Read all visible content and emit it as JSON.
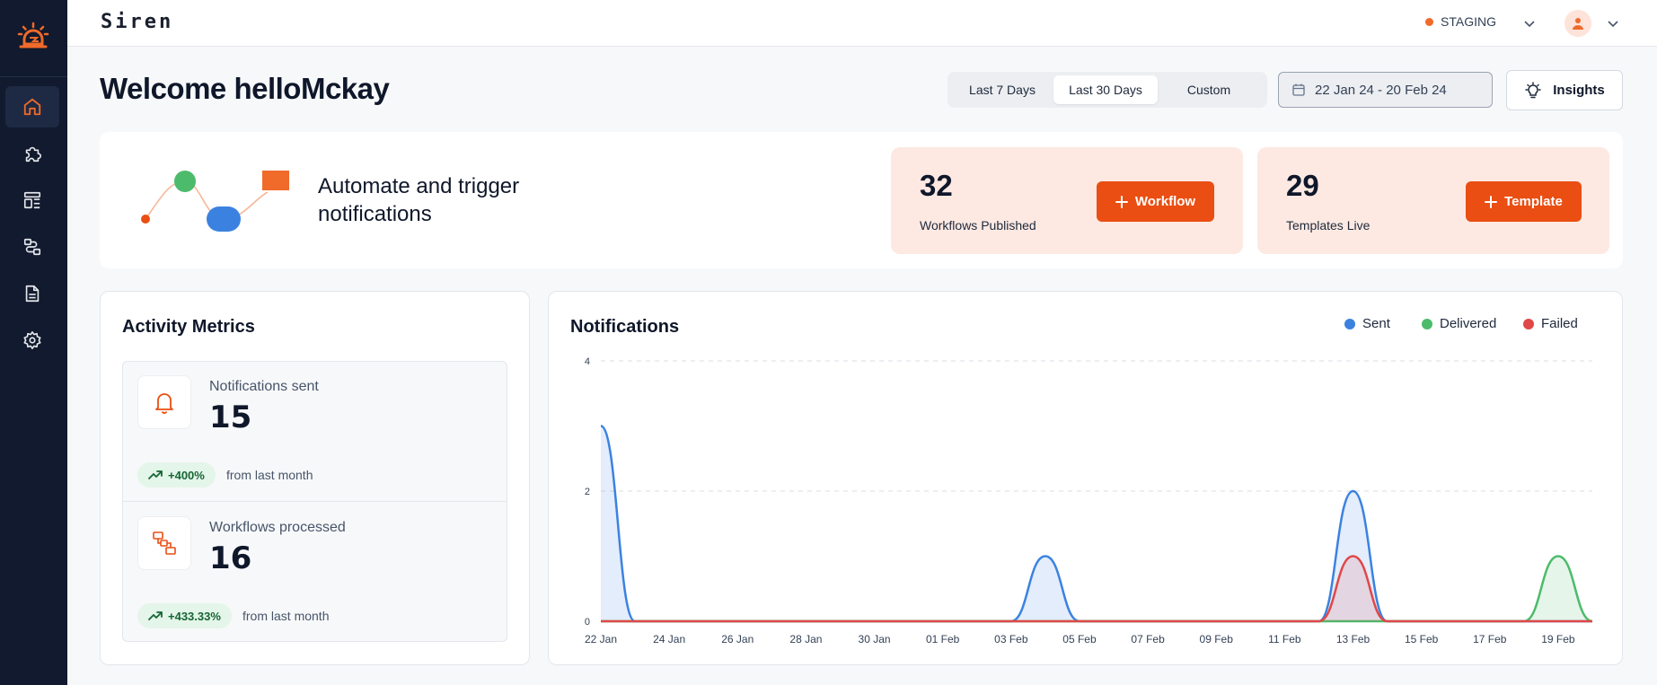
{
  "app": {
    "brand": "Siren"
  },
  "sidebar": {
    "items": [
      {
        "icon": "home-icon",
        "active": true
      },
      {
        "icon": "puzzle-icon"
      },
      {
        "icon": "layout-icon"
      },
      {
        "icon": "workflow-icon"
      },
      {
        "icon": "document-icon"
      },
      {
        "icon": "gear-icon"
      }
    ]
  },
  "topbar": {
    "environment": "STAGING",
    "env_color": "#f06a2a"
  },
  "header": {
    "welcome": "Welcome helloMckay",
    "range_tabs": [
      "Last 7 Days",
      "Last 30 Days",
      "Custom"
    ],
    "selected_range": "Last 30 Days",
    "date_range": "22 Jan 24 - 20 Feb 24",
    "insights_label": "Insights"
  },
  "banner": {
    "headline": "Automate and trigger notifications",
    "workflows": {
      "count": "32",
      "label": "Workflows Published",
      "button": "Workflow"
    },
    "templates": {
      "count": "29",
      "label": "Templates Live",
      "button": "Template"
    }
  },
  "activity": {
    "title": "Activity Metrics",
    "metrics": [
      {
        "label": "Notifications sent",
        "value": "15",
        "change": "+400%",
        "sub": "from last month",
        "icon": "bell-icon"
      },
      {
        "label": "Workflows processed",
        "value": "16",
        "change": "+433.33%",
        "sub": "from last month",
        "icon": "workflow-icon"
      }
    ]
  },
  "notifications": {
    "title": "Notifications",
    "legend": [
      {
        "name": "Sent",
        "color": "#3b82e0"
      },
      {
        "name": "Delivered",
        "color": "#4cbb6c"
      },
      {
        "name": "Failed",
        "color": "#e04848"
      }
    ]
  },
  "chart_data": {
    "type": "area",
    "title": "Notifications",
    "x": [
      "22 Jan",
      "23 Jan",
      "24 Jan",
      "25 Jan",
      "26 Jan",
      "27 Jan",
      "28 Jan",
      "29 Jan",
      "30 Jan",
      "31 Jan",
      "01 Feb",
      "02 Feb",
      "03 Feb",
      "04 Feb",
      "05 Feb",
      "06 Feb",
      "07 Feb",
      "08 Feb",
      "09 Feb",
      "10 Feb",
      "11 Feb",
      "12 Feb",
      "13 Feb",
      "14 Feb",
      "15 Feb",
      "16 Feb",
      "17 Feb",
      "18 Feb",
      "19 Feb",
      "20 Feb"
    ],
    "x_tick_labels": [
      "22 Jan",
      "24 Jan",
      "26 Jan",
      "28 Jan",
      "30 Jan",
      "01 Feb",
      "03 Feb",
      "05 Feb",
      "07 Feb",
      "09 Feb",
      "11 Feb",
      "13 Feb",
      "15 Feb",
      "17 Feb",
      "19 Feb"
    ],
    "series": [
      {
        "name": "Sent",
        "values": [
          3,
          0,
          0,
          0,
          0,
          0,
          0,
          0,
          0,
          0,
          0,
          0,
          0,
          1,
          0,
          0,
          0,
          0,
          0,
          0,
          0,
          0,
          2,
          0,
          0,
          0,
          0,
          0,
          0,
          0
        ]
      },
      {
        "name": "Delivered",
        "values": [
          0,
          0,
          0,
          0,
          0,
          0,
          0,
          0,
          0,
          0,
          0,
          0,
          0,
          0,
          0,
          0,
          0,
          0,
          0,
          0,
          0,
          0,
          0,
          0,
          0,
          0,
          0,
          0,
          1,
          0
        ]
      },
      {
        "name": "Failed",
        "values": [
          0,
          0,
          0,
          0,
          0,
          0,
          0,
          0,
          0,
          0,
          0,
          0,
          0,
          0,
          0,
          0,
          0,
          0,
          0,
          0,
          0,
          0,
          1,
          0,
          0,
          0,
          0,
          0,
          0,
          0
        ]
      }
    ],
    "y_ticks": [
      0,
      2,
      4
    ],
    "ylim": [
      0,
      4
    ],
    "grid": "horizontal-dashed",
    "legend_position": "top-right"
  }
}
